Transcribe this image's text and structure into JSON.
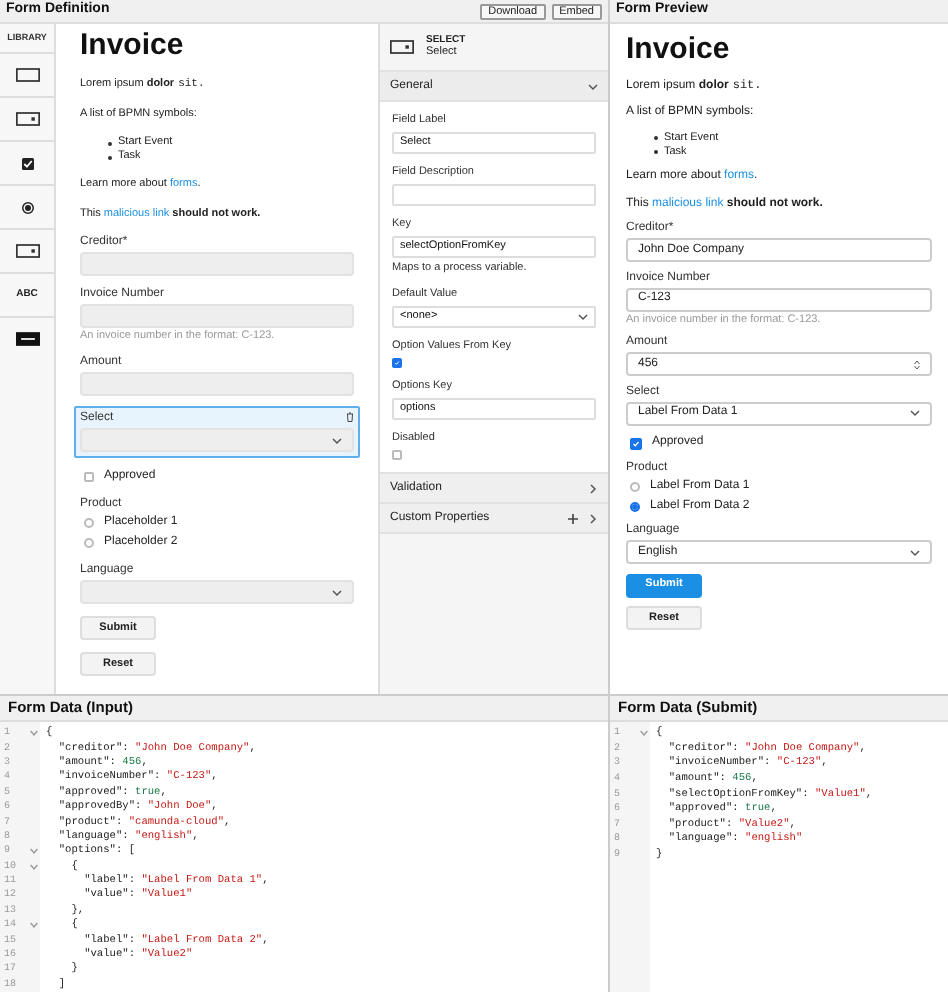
{
  "editor": {
    "title": "Form Definition",
    "actions": [
      "Download",
      "Embed"
    ],
    "library": {
      "title": "LIBRARY",
      "items": [
        {
          "kind": "textfield"
        },
        {
          "kind": "select"
        },
        {
          "kind": "checkbox"
        },
        {
          "kind": "radio"
        },
        {
          "kind": "number"
        },
        {
          "kind": "text",
          "label": "ABC"
        },
        {
          "kind": "button"
        }
      ]
    },
    "components": [
      {
        "kind": "heading",
        "text": "Invoice",
        "selected": false
      },
      {
        "kind": "paragraph",
        "parts": [
          {
            "kind": "plain",
            "text": "Lorem ipsum "
          },
          {
            "kind": "bold",
            "text": "dolor"
          },
          {
            "kind": "code",
            "text": "sit."
          }
        ],
        "selected": false
      },
      {
        "kind": "paragraph",
        "parts": [
          {
            "kind": "plain",
            "text": "A list of BPMN symbols:"
          }
        ],
        "selected": false
      },
      {
        "kind": "list",
        "items": [
          "Start Event",
          "Task"
        ],
        "selected": false
      },
      {
        "kind": "paragraph",
        "parts": [
          {
            "kind": "plain",
            "text": "Learn more about "
          },
          {
            "kind": "link",
            "text": "forms"
          },
          {
            "kind": "plain",
            "text": "."
          }
        ],
        "selected": false
      },
      {
        "kind": "paragraph",
        "parts": [
          {
            "kind": "plain",
            "text": "This "
          },
          {
            "kind": "link",
            "text": "malicious link"
          },
          {
            "kind": "bold",
            "text": " should not work."
          }
        ],
        "selected": false
      },
      {
        "kind": "textfield",
        "label": "Creditor*",
        "selected": false
      },
      {
        "kind": "textfield",
        "label": "Invoice Number",
        "description": "An invoice number in the format: C-123.",
        "selected": false
      },
      {
        "kind": "textfield",
        "label": "Amount",
        "selected": false
      },
      {
        "kind": "select",
        "label": "Select",
        "selected": true
      },
      {
        "kind": "checkbox",
        "label": "Approved",
        "checked": false,
        "selected": false
      },
      {
        "kind": "radio",
        "label": "Product",
        "options": [
          {
            "label": "Placeholder 1",
            "selected": false
          },
          {
            "label": "Placeholder 2",
            "selected": false
          }
        ],
        "selected": false
      },
      {
        "kind": "select",
        "label": "Language",
        "selected": false
      },
      {
        "kind": "button",
        "label": "Submit",
        "primary": false,
        "selected": false
      },
      {
        "kind": "button",
        "label": "Reset",
        "primary": false,
        "selected": false
      }
    ]
  },
  "properties": {
    "type": "SELECT",
    "label": "Select",
    "groups": [
      {
        "title": "General",
        "expanded": true,
        "entries": [
          {
            "kind": "text",
            "label": "Field Label",
            "value": "Select"
          },
          {
            "kind": "text",
            "label": "Field Description"
          },
          {
            "kind": "text",
            "label": "Key",
            "value": "selectOptionFromKey",
            "description": "Maps to a process variable."
          },
          {
            "kind": "select",
            "label": "Default Value",
            "value": "<none>"
          },
          {
            "kind": "checkbox",
            "label": "Option Values From Key",
            "checked": true
          },
          {
            "kind": "text",
            "label": "Options Key",
            "value": "options"
          },
          {
            "kind": "checkbox",
            "label": "Disabled",
            "checked": false
          }
        ]
      },
      {
        "title": "Validation",
        "expanded": false,
        "addable": false
      },
      {
        "title": "Custom Properties",
        "expanded": false,
        "addable": true
      }
    ]
  },
  "preview": {
    "title": "Form Preview",
    "components": [
      {
        "kind": "heading",
        "text": "Invoice"
      },
      {
        "kind": "paragraph",
        "parts": [
          {
            "kind": "plain",
            "text": "Lorem ipsum "
          },
          {
            "kind": "bold",
            "text": "dolor"
          },
          {
            "kind": "code",
            "text": "sit."
          }
        ]
      },
      {
        "kind": "paragraph",
        "parts": [
          {
            "kind": "plain",
            "text": "A list of BPMN symbols:"
          }
        ]
      },
      {
        "kind": "list",
        "items": [
          "Start Event",
          "Task"
        ]
      },
      {
        "kind": "paragraph",
        "parts": [
          {
            "kind": "plain",
            "text": "Learn more about "
          },
          {
            "kind": "link",
            "text": "forms"
          },
          {
            "kind": "plain",
            "text": "."
          }
        ]
      },
      {
        "kind": "paragraph",
        "parts": [
          {
            "kind": "plain",
            "text": "This "
          },
          {
            "kind": "link",
            "text": "malicious link"
          },
          {
            "kind": "bold",
            "text": " should not work."
          }
        ]
      },
      {
        "kind": "textfield",
        "label": "Creditor*",
        "value": "John Doe Company"
      },
      {
        "kind": "textfield",
        "label": "Invoice Number",
        "value": "C-123",
        "description": "An invoice number in the format: C-123."
      },
      {
        "kind": "number",
        "label": "Amount",
        "value": "456"
      },
      {
        "kind": "select",
        "label": "Select",
        "value": "Label From Data 1"
      },
      {
        "kind": "checkbox",
        "label": "Approved",
        "checked": true
      },
      {
        "kind": "radio",
        "label": "Product",
        "options": [
          {
            "label": "Label From Data 1",
            "selected": false
          },
          {
            "label": "Label From Data 2",
            "selected": true
          }
        ]
      },
      {
        "kind": "select",
        "label": "Language",
        "value": "English"
      },
      {
        "kind": "button",
        "label": "Submit",
        "primary": true
      },
      {
        "kind": "button",
        "label": "Reset",
        "primary": false
      }
    ]
  },
  "input_data": {
    "title": "Form Data (Input)",
    "lines": [
      {
        "number": "1",
        "fold": true,
        "text": "{"
      },
      {
        "number": "2",
        "fold": false,
        "text": "  \"creditor\": \"John Doe Company\","
      },
      {
        "number": "3",
        "fold": false,
        "text": "  \"amount\": 456,"
      },
      {
        "number": "4",
        "fold": false,
        "text": "  \"invoiceNumber\": \"C-123\","
      },
      {
        "number": "5",
        "fold": false,
        "text": "  \"approved\": true,"
      },
      {
        "number": "6",
        "fold": false,
        "text": "  \"approvedBy\": \"John Doe\","
      },
      {
        "number": "7",
        "fold": false,
        "text": "  \"product\": \"camunda-cloud\","
      },
      {
        "number": "8",
        "fold": false,
        "text": "  \"language\": \"english\","
      },
      {
        "number": "9",
        "fold": true,
        "text": "  \"options\": ["
      },
      {
        "number": "10",
        "fold": true,
        "text": "    {"
      },
      {
        "number": "11",
        "fold": false,
        "text": "      \"label\": \"Label From Data 1\","
      },
      {
        "number": "12",
        "fold": false,
        "text": "      \"value\": \"Value1\""
      },
      {
        "number": "13",
        "fold": false,
        "text": "    },"
      },
      {
        "number": "14",
        "fold": true,
        "text": "    {"
      },
      {
        "number": "15",
        "fold": false,
        "text": "      \"label\": \"Label From Data 2\","
      },
      {
        "number": "16",
        "fold": false,
        "text": "      \"value\": \"Value2\""
      },
      {
        "number": "17",
        "fold": false,
        "text": "    }"
      },
      {
        "number": "18",
        "fold": false,
        "text": "  ]"
      }
    ]
  },
  "submit_data": {
    "title": "Form Data (Submit)",
    "lines": [
      {
        "number": "1",
        "fold": true,
        "text": "{"
      },
      {
        "number": "2",
        "fold": false,
        "text": "  \"creditor\": \"John Doe Company\","
      },
      {
        "number": "3",
        "fold": false,
        "text": "  \"invoiceNumber\": \"C-123\","
      },
      {
        "number": "4",
        "fold": false,
        "text": "  \"amount\": 456,"
      },
      {
        "number": "5",
        "fold": false,
        "text": "  \"selectOptionFromKey\": \"Value1\","
      },
      {
        "number": "6",
        "fold": false,
        "text": "  \"approved\": true,"
      },
      {
        "number": "7",
        "fold": false,
        "text": "  \"product\": \"Value2\","
      },
      {
        "number": "8",
        "fold": false,
        "text": "  \"language\": \"english\""
      },
      {
        "number": "9",
        "fold": false,
        "text": "}"
      }
    ]
  }
}
